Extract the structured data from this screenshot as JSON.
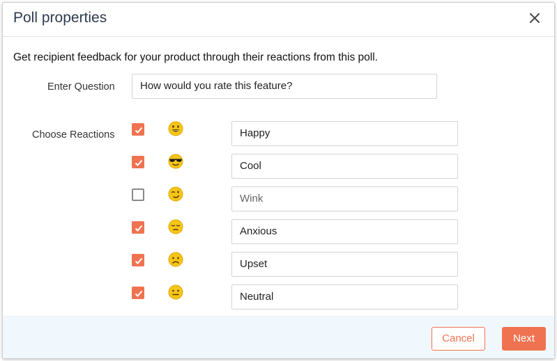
{
  "dialog": {
    "title": "Poll properties",
    "close_icon": "close-icon"
  },
  "intro_text": "Get recipient feedback for your product through their reactions from this poll.",
  "question": {
    "label": "Enter Question",
    "value": "How would you rate this feature?"
  },
  "reactions": {
    "label": "Choose Reactions",
    "items": [
      {
        "checked": true,
        "emoji": "grinning-face-icon",
        "value": "Happy"
      },
      {
        "checked": true,
        "emoji": "sunglasses-face-icon",
        "value": "Cool"
      },
      {
        "checked": false,
        "emoji": "winking-face-icon",
        "value": "Wink"
      },
      {
        "checked": true,
        "emoji": "anxious-face-icon",
        "value": "Anxious"
      },
      {
        "checked": true,
        "emoji": "frowning-face-icon",
        "value": "Upset"
      },
      {
        "checked": true,
        "emoji": "neutral-face-icon",
        "value": "Neutral"
      }
    ]
  },
  "footer": {
    "cancel_label": "Cancel",
    "next_label": "Next"
  },
  "colors": {
    "accent": "#f07351",
    "emoji_yellow": "#f5c518",
    "footer_bg": "#f1f8fd",
    "title": "#2d3b4e"
  }
}
